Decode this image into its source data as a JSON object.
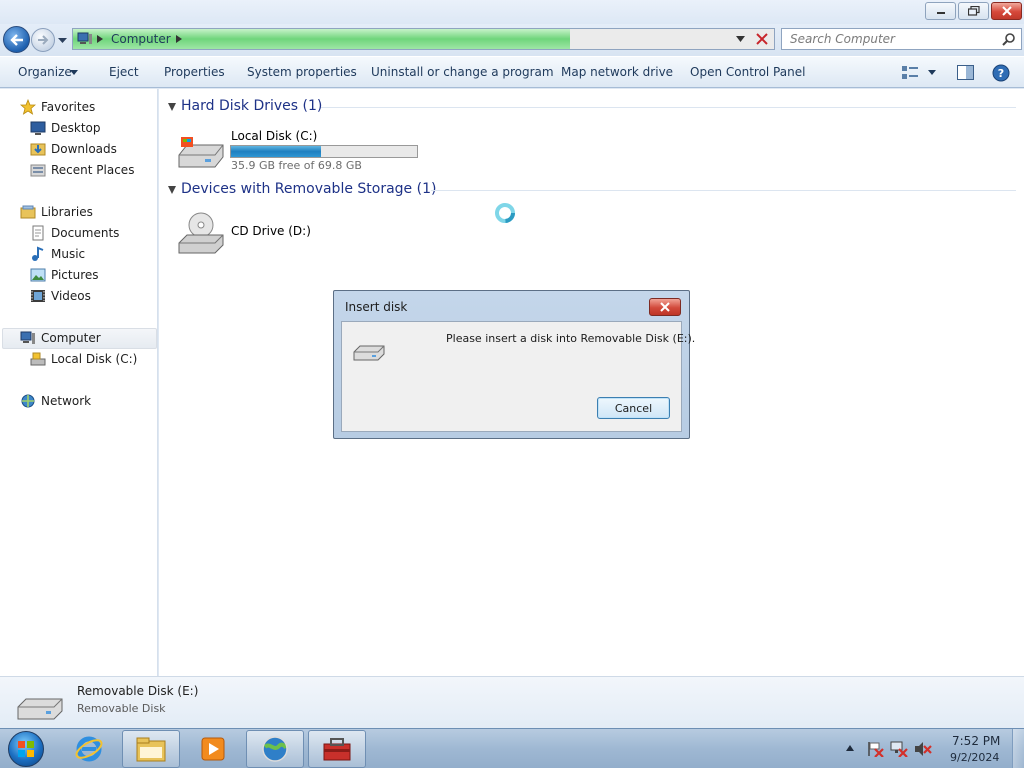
{
  "window": {
    "address_path": "Computer",
    "search_placeholder": "Search Computer"
  },
  "toolbar": {
    "organize": "Organize",
    "eject": "Eject",
    "properties": "Properties",
    "system_properties": "System properties",
    "uninstall": "Uninstall or change a program",
    "map_network_drive": "Map network drive",
    "open_control_panel": "Open Control Panel"
  },
  "nav": {
    "favorites": "Favorites",
    "desktop": "Desktop",
    "downloads": "Downloads",
    "recent_places": "Recent Places",
    "libraries": "Libraries",
    "documents": "Documents",
    "music": "Music",
    "pictures": "Pictures",
    "videos": "Videos",
    "computer": "Computer",
    "local_disk": "Local Disk (C:)",
    "network": "Network"
  },
  "content": {
    "hdd_group": "Hard Disk Drives (1)",
    "removable_group": "Devices with Removable Storage (1)",
    "drive_c": {
      "name": "Local Disk (C:)",
      "free_text": "35.9 GB free of 69.8 GB",
      "used_fraction": 0.486
    },
    "drive_d": {
      "name": "CD Drive (D:)"
    }
  },
  "dialog": {
    "title": "Insert disk",
    "message": "Please insert a disk into Removable Disk (E:).",
    "cancel": "Cancel"
  },
  "details": {
    "name": "Removable Disk (E:)",
    "type": "Removable Disk"
  },
  "taskbar": {
    "time": "7:52 PM",
    "date": "9/2/2024"
  },
  "colors": {
    "accent_blue": "#1e3287",
    "drive_bar": "#1f7fc0",
    "address_progress": "#6fd57b"
  }
}
